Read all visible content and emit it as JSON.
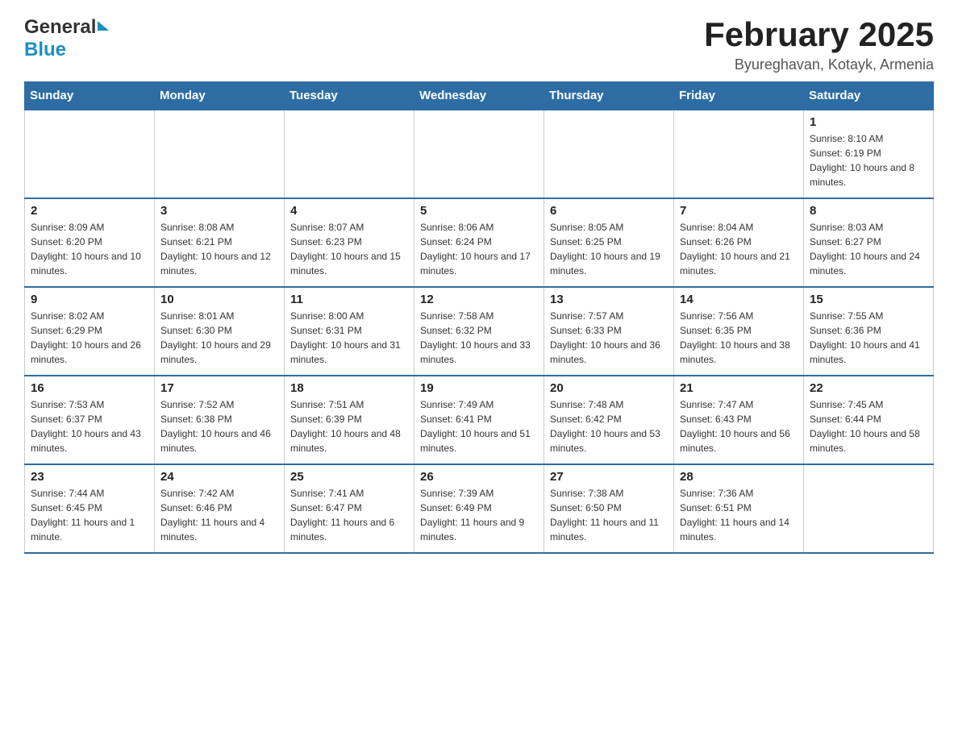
{
  "header": {
    "logo_general": "General",
    "logo_blue": "Blue",
    "title": "February 2025",
    "subtitle": "Byureghavan, Kotayk, Armenia"
  },
  "calendar": {
    "days_of_week": [
      "Sunday",
      "Monday",
      "Tuesday",
      "Wednesday",
      "Thursday",
      "Friday",
      "Saturday"
    ],
    "weeks": [
      [
        {
          "day": "",
          "info": ""
        },
        {
          "day": "",
          "info": ""
        },
        {
          "day": "",
          "info": ""
        },
        {
          "day": "",
          "info": ""
        },
        {
          "day": "",
          "info": ""
        },
        {
          "day": "",
          "info": ""
        },
        {
          "day": "1",
          "info": "Sunrise: 8:10 AM\nSunset: 6:19 PM\nDaylight: 10 hours and 8 minutes."
        }
      ],
      [
        {
          "day": "2",
          "info": "Sunrise: 8:09 AM\nSunset: 6:20 PM\nDaylight: 10 hours and 10 minutes."
        },
        {
          "day": "3",
          "info": "Sunrise: 8:08 AM\nSunset: 6:21 PM\nDaylight: 10 hours and 12 minutes."
        },
        {
          "day": "4",
          "info": "Sunrise: 8:07 AM\nSunset: 6:23 PM\nDaylight: 10 hours and 15 minutes."
        },
        {
          "day": "5",
          "info": "Sunrise: 8:06 AM\nSunset: 6:24 PM\nDaylight: 10 hours and 17 minutes."
        },
        {
          "day": "6",
          "info": "Sunrise: 8:05 AM\nSunset: 6:25 PM\nDaylight: 10 hours and 19 minutes."
        },
        {
          "day": "7",
          "info": "Sunrise: 8:04 AM\nSunset: 6:26 PM\nDaylight: 10 hours and 21 minutes."
        },
        {
          "day": "8",
          "info": "Sunrise: 8:03 AM\nSunset: 6:27 PM\nDaylight: 10 hours and 24 minutes."
        }
      ],
      [
        {
          "day": "9",
          "info": "Sunrise: 8:02 AM\nSunset: 6:29 PM\nDaylight: 10 hours and 26 minutes."
        },
        {
          "day": "10",
          "info": "Sunrise: 8:01 AM\nSunset: 6:30 PM\nDaylight: 10 hours and 29 minutes."
        },
        {
          "day": "11",
          "info": "Sunrise: 8:00 AM\nSunset: 6:31 PM\nDaylight: 10 hours and 31 minutes."
        },
        {
          "day": "12",
          "info": "Sunrise: 7:58 AM\nSunset: 6:32 PM\nDaylight: 10 hours and 33 minutes."
        },
        {
          "day": "13",
          "info": "Sunrise: 7:57 AM\nSunset: 6:33 PM\nDaylight: 10 hours and 36 minutes."
        },
        {
          "day": "14",
          "info": "Sunrise: 7:56 AM\nSunset: 6:35 PM\nDaylight: 10 hours and 38 minutes."
        },
        {
          "day": "15",
          "info": "Sunrise: 7:55 AM\nSunset: 6:36 PM\nDaylight: 10 hours and 41 minutes."
        }
      ],
      [
        {
          "day": "16",
          "info": "Sunrise: 7:53 AM\nSunset: 6:37 PM\nDaylight: 10 hours and 43 minutes."
        },
        {
          "day": "17",
          "info": "Sunrise: 7:52 AM\nSunset: 6:38 PM\nDaylight: 10 hours and 46 minutes."
        },
        {
          "day": "18",
          "info": "Sunrise: 7:51 AM\nSunset: 6:39 PM\nDaylight: 10 hours and 48 minutes."
        },
        {
          "day": "19",
          "info": "Sunrise: 7:49 AM\nSunset: 6:41 PM\nDaylight: 10 hours and 51 minutes."
        },
        {
          "day": "20",
          "info": "Sunrise: 7:48 AM\nSunset: 6:42 PM\nDaylight: 10 hours and 53 minutes."
        },
        {
          "day": "21",
          "info": "Sunrise: 7:47 AM\nSunset: 6:43 PM\nDaylight: 10 hours and 56 minutes."
        },
        {
          "day": "22",
          "info": "Sunrise: 7:45 AM\nSunset: 6:44 PM\nDaylight: 10 hours and 58 minutes."
        }
      ],
      [
        {
          "day": "23",
          "info": "Sunrise: 7:44 AM\nSunset: 6:45 PM\nDaylight: 11 hours and 1 minute."
        },
        {
          "day": "24",
          "info": "Sunrise: 7:42 AM\nSunset: 6:46 PM\nDaylight: 11 hours and 4 minutes."
        },
        {
          "day": "25",
          "info": "Sunrise: 7:41 AM\nSunset: 6:47 PM\nDaylight: 11 hours and 6 minutes."
        },
        {
          "day": "26",
          "info": "Sunrise: 7:39 AM\nSunset: 6:49 PM\nDaylight: 11 hours and 9 minutes."
        },
        {
          "day": "27",
          "info": "Sunrise: 7:38 AM\nSunset: 6:50 PM\nDaylight: 11 hours and 11 minutes."
        },
        {
          "day": "28",
          "info": "Sunrise: 7:36 AM\nSunset: 6:51 PM\nDaylight: 11 hours and 14 minutes."
        },
        {
          "day": "",
          "info": ""
        }
      ]
    ]
  }
}
